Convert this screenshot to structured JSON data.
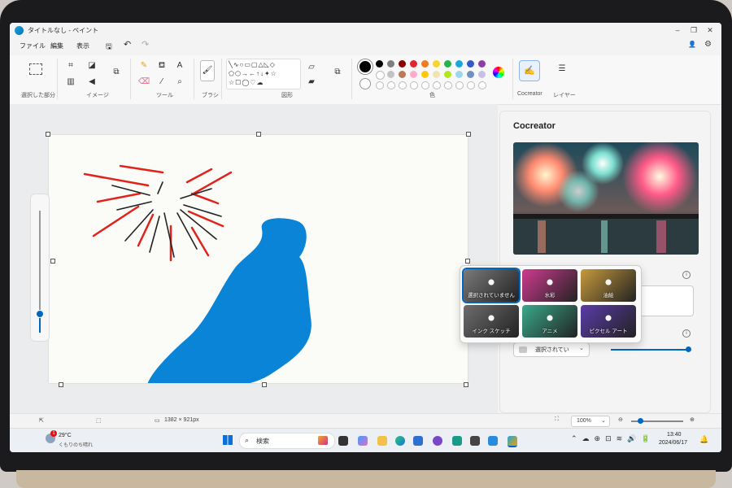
{
  "window": {
    "title": "タイトルなし - ペイント"
  },
  "menu": [
    "ファイル",
    "編集",
    "表示"
  ],
  "ribbon": {
    "groups": {
      "selection": "選択した部分",
      "image": "イメージ",
      "tools": "ツール",
      "brushes": "ブラシ",
      "shapes": "図形",
      "colors": "色",
      "cocreator": "Cocreator",
      "layers": "レイヤー"
    },
    "palette_row1": [
      "#000000",
      "#7f7f7f",
      "#8b0000",
      "#e3262e",
      "#f47a20",
      "#f7d531",
      "#2ab24a",
      "#1aa7dc",
      "#3659c9",
      "#8e3fa6"
    ],
    "palette_row2": [
      "#ffffff",
      "#c3c3c3",
      "#b97a57",
      "#ffaec9",
      "#ffc90e",
      "#efe4b0",
      "#b5e61d",
      "#99d9ea",
      "#7092be",
      "#c8bfe7"
    ]
  },
  "panel": {
    "title": "Cocreator",
    "dropdown_value": "選択されてい"
  },
  "styles": [
    {
      "label": "選択されていません",
      "bg": "#7a7a7a"
    },
    {
      "label": "水彩",
      "bg": "#cf3b8f"
    },
    {
      "label": "油絵",
      "bg": "#c79a3e"
    },
    {
      "label": "インク スケッチ",
      "bg": "#6d6d6d"
    },
    {
      "label": "アニメ",
      "bg": "#3aa98a"
    },
    {
      "label": "ピクセル アート",
      "bg": "#5a3ca8"
    }
  ],
  "status": {
    "canvas_size": "1382 × 921px",
    "zoom": "100%"
  },
  "taskbar": {
    "search_placeholder": "検索",
    "temp": "29°C",
    "weather": "くもりのち晴れ",
    "time": "13:40",
    "date": "2024/06/17",
    "weather_badge": "1"
  },
  "colors": {
    "accent": "#0067c0",
    "stroke_red": "#e0241b",
    "stroke_dark": "#222222",
    "fill_blue": "#0a84d6"
  }
}
